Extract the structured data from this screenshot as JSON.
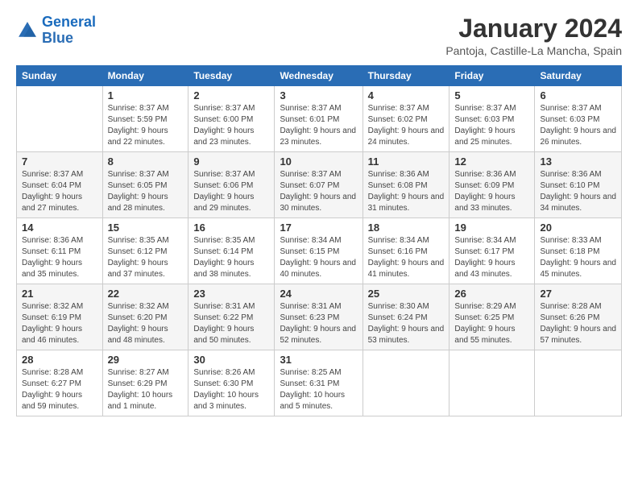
{
  "logo": {
    "text_general": "General",
    "text_blue": "Blue"
  },
  "header": {
    "month_title": "January 2024",
    "location": "Pantoja, Castille-La Mancha, Spain"
  },
  "weekdays": [
    "Sunday",
    "Monday",
    "Tuesday",
    "Wednesday",
    "Thursday",
    "Friday",
    "Saturday"
  ],
  "weeks": [
    [
      {
        "day": "",
        "sunrise": "",
        "sunset": "",
        "daylight": ""
      },
      {
        "day": "1",
        "sunrise": "Sunrise: 8:37 AM",
        "sunset": "Sunset: 5:59 PM",
        "daylight": "Daylight: 9 hours and 22 minutes."
      },
      {
        "day": "2",
        "sunrise": "Sunrise: 8:37 AM",
        "sunset": "Sunset: 6:00 PM",
        "daylight": "Daylight: 9 hours and 23 minutes."
      },
      {
        "day": "3",
        "sunrise": "Sunrise: 8:37 AM",
        "sunset": "Sunset: 6:01 PM",
        "daylight": "Daylight: 9 hours and 23 minutes."
      },
      {
        "day": "4",
        "sunrise": "Sunrise: 8:37 AM",
        "sunset": "Sunset: 6:02 PM",
        "daylight": "Daylight: 9 hours and 24 minutes."
      },
      {
        "day": "5",
        "sunrise": "Sunrise: 8:37 AM",
        "sunset": "Sunset: 6:03 PM",
        "daylight": "Daylight: 9 hours and 25 minutes."
      },
      {
        "day": "6",
        "sunrise": "Sunrise: 8:37 AM",
        "sunset": "Sunset: 6:03 PM",
        "daylight": "Daylight: 9 hours and 26 minutes."
      }
    ],
    [
      {
        "day": "7",
        "sunrise": "Sunrise: 8:37 AM",
        "sunset": "Sunset: 6:04 PM",
        "daylight": "Daylight: 9 hours and 27 minutes."
      },
      {
        "day": "8",
        "sunrise": "Sunrise: 8:37 AM",
        "sunset": "Sunset: 6:05 PM",
        "daylight": "Daylight: 9 hours and 28 minutes."
      },
      {
        "day": "9",
        "sunrise": "Sunrise: 8:37 AM",
        "sunset": "Sunset: 6:06 PM",
        "daylight": "Daylight: 9 hours and 29 minutes."
      },
      {
        "day": "10",
        "sunrise": "Sunrise: 8:37 AM",
        "sunset": "Sunset: 6:07 PM",
        "daylight": "Daylight: 9 hours and 30 minutes."
      },
      {
        "day": "11",
        "sunrise": "Sunrise: 8:36 AM",
        "sunset": "Sunset: 6:08 PM",
        "daylight": "Daylight: 9 hours and 31 minutes."
      },
      {
        "day": "12",
        "sunrise": "Sunrise: 8:36 AM",
        "sunset": "Sunset: 6:09 PM",
        "daylight": "Daylight: 9 hours and 33 minutes."
      },
      {
        "day": "13",
        "sunrise": "Sunrise: 8:36 AM",
        "sunset": "Sunset: 6:10 PM",
        "daylight": "Daylight: 9 hours and 34 minutes."
      }
    ],
    [
      {
        "day": "14",
        "sunrise": "Sunrise: 8:36 AM",
        "sunset": "Sunset: 6:11 PM",
        "daylight": "Daylight: 9 hours and 35 minutes."
      },
      {
        "day": "15",
        "sunrise": "Sunrise: 8:35 AM",
        "sunset": "Sunset: 6:12 PM",
        "daylight": "Daylight: 9 hours and 37 minutes."
      },
      {
        "day": "16",
        "sunrise": "Sunrise: 8:35 AM",
        "sunset": "Sunset: 6:14 PM",
        "daylight": "Daylight: 9 hours and 38 minutes."
      },
      {
        "day": "17",
        "sunrise": "Sunrise: 8:34 AM",
        "sunset": "Sunset: 6:15 PM",
        "daylight": "Daylight: 9 hours and 40 minutes."
      },
      {
        "day": "18",
        "sunrise": "Sunrise: 8:34 AM",
        "sunset": "Sunset: 6:16 PM",
        "daylight": "Daylight: 9 hours and 41 minutes."
      },
      {
        "day": "19",
        "sunrise": "Sunrise: 8:34 AM",
        "sunset": "Sunset: 6:17 PM",
        "daylight": "Daylight: 9 hours and 43 minutes."
      },
      {
        "day": "20",
        "sunrise": "Sunrise: 8:33 AM",
        "sunset": "Sunset: 6:18 PM",
        "daylight": "Daylight: 9 hours and 45 minutes."
      }
    ],
    [
      {
        "day": "21",
        "sunrise": "Sunrise: 8:32 AM",
        "sunset": "Sunset: 6:19 PM",
        "daylight": "Daylight: 9 hours and 46 minutes."
      },
      {
        "day": "22",
        "sunrise": "Sunrise: 8:32 AM",
        "sunset": "Sunset: 6:20 PM",
        "daylight": "Daylight: 9 hours and 48 minutes."
      },
      {
        "day": "23",
        "sunrise": "Sunrise: 8:31 AM",
        "sunset": "Sunset: 6:22 PM",
        "daylight": "Daylight: 9 hours and 50 minutes."
      },
      {
        "day": "24",
        "sunrise": "Sunrise: 8:31 AM",
        "sunset": "Sunset: 6:23 PM",
        "daylight": "Daylight: 9 hours and 52 minutes."
      },
      {
        "day": "25",
        "sunrise": "Sunrise: 8:30 AM",
        "sunset": "Sunset: 6:24 PM",
        "daylight": "Daylight: 9 hours and 53 minutes."
      },
      {
        "day": "26",
        "sunrise": "Sunrise: 8:29 AM",
        "sunset": "Sunset: 6:25 PM",
        "daylight": "Daylight: 9 hours and 55 minutes."
      },
      {
        "day": "27",
        "sunrise": "Sunrise: 8:28 AM",
        "sunset": "Sunset: 6:26 PM",
        "daylight": "Daylight: 9 hours and 57 minutes."
      }
    ],
    [
      {
        "day": "28",
        "sunrise": "Sunrise: 8:28 AM",
        "sunset": "Sunset: 6:27 PM",
        "daylight": "Daylight: 9 hours and 59 minutes."
      },
      {
        "day": "29",
        "sunrise": "Sunrise: 8:27 AM",
        "sunset": "Sunset: 6:29 PM",
        "daylight": "Daylight: 10 hours and 1 minute."
      },
      {
        "day": "30",
        "sunrise": "Sunrise: 8:26 AM",
        "sunset": "Sunset: 6:30 PM",
        "daylight": "Daylight: 10 hours and 3 minutes."
      },
      {
        "day": "31",
        "sunrise": "Sunrise: 8:25 AM",
        "sunset": "Sunset: 6:31 PM",
        "daylight": "Daylight: 10 hours and 5 minutes."
      },
      {
        "day": "",
        "sunrise": "",
        "sunset": "",
        "daylight": ""
      },
      {
        "day": "",
        "sunrise": "",
        "sunset": "",
        "daylight": ""
      },
      {
        "day": "",
        "sunrise": "",
        "sunset": "",
        "daylight": ""
      }
    ]
  ]
}
